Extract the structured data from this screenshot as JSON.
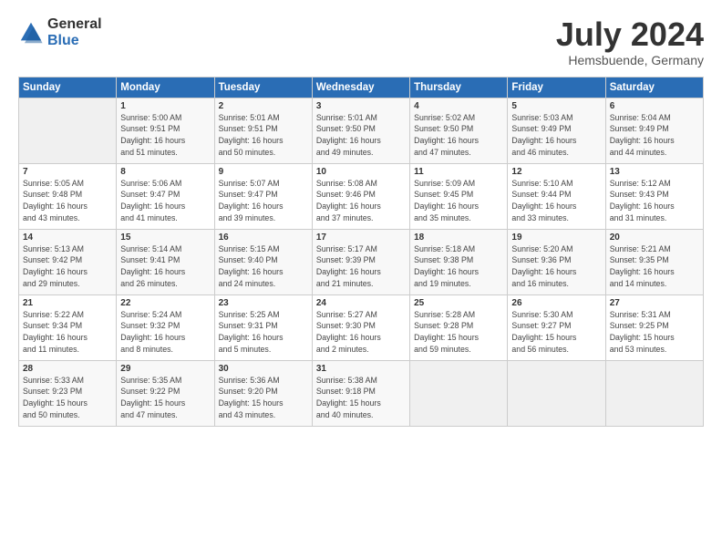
{
  "logo": {
    "general": "General",
    "blue": "Blue"
  },
  "header": {
    "month": "July 2024",
    "location": "Hemsbuende, Germany"
  },
  "weekdays": [
    "Sunday",
    "Monday",
    "Tuesday",
    "Wednesday",
    "Thursday",
    "Friday",
    "Saturday"
  ],
  "weeks": [
    [
      {
        "day": "",
        "info": ""
      },
      {
        "day": "1",
        "info": "Sunrise: 5:00 AM\nSunset: 9:51 PM\nDaylight: 16 hours\nand 51 minutes."
      },
      {
        "day": "2",
        "info": "Sunrise: 5:01 AM\nSunset: 9:51 PM\nDaylight: 16 hours\nand 50 minutes."
      },
      {
        "day": "3",
        "info": "Sunrise: 5:01 AM\nSunset: 9:50 PM\nDaylight: 16 hours\nand 49 minutes."
      },
      {
        "day": "4",
        "info": "Sunrise: 5:02 AM\nSunset: 9:50 PM\nDaylight: 16 hours\nand 47 minutes."
      },
      {
        "day": "5",
        "info": "Sunrise: 5:03 AM\nSunset: 9:49 PM\nDaylight: 16 hours\nand 46 minutes."
      },
      {
        "day": "6",
        "info": "Sunrise: 5:04 AM\nSunset: 9:49 PM\nDaylight: 16 hours\nand 44 minutes."
      }
    ],
    [
      {
        "day": "7",
        "info": "Sunrise: 5:05 AM\nSunset: 9:48 PM\nDaylight: 16 hours\nand 43 minutes."
      },
      {
        "day": "8",
        "info": "Sunrise: 5:06 AM\nSunset: 9:47 PM\nDaylight: 16 hours\nand 41 minutes."
      },
      {
        "day": "9",
        "info": "Sunrise: 5:07 AM\nSunset: 9:47 PM\nDaylight: 16 hours\nand 39 minutes."
      },
      {
        "day": "10",
        "info": "Sunrise: 5:08 AM\nSunset: 9:46 PM\nDaylight: 16 hours\nand 37 minutes."
      },
      {
        "day": "11",
        "info": "Sunrise: 5:09 AM\nSunset: 9:45 PM\nDaylight: 16 hours\nand 35 minutes."
      },
      {
        "day": "12",
        "info": "Sunrise: 5:10 AM\nSunset: 9:44 PM\nDaylight: 16 hours\nand 33 minutes."
      },
      {
        "day": "13",
        "info": "Sunrise: 5:12 AM\nSunset: 9:43 PM\nDaylight: 16 hours\nand 31 minutes."
      }
    ],
    [
      {
        "day": "14",
        "info": "Sunrise: 5:13 AM\nSunset: 9:42 PM\nDaylight: 16 hours\nand 29 minutes."
      },
      {
        "day": "15",
        "info": "Sunrise: 5:14 AM\nSunset: 9:41 PM\nDaylight: 16 hours\nand 26 minutes."
      },
      {
        "day": "16",
        "info": "Sunrise: 5:15 AM\nSunset: 9:40 PM\nDaylight: 16 hours\nand 24 minutes."
      },
      {
        "day": "17",
        "info": "Sunrise: 5:17 AM\nSunset: 9:39 PM\nDaylight: 16 hours\nand 21 minutes."
      },
      {
        "day": "18",
        "info": "Sunrise: 5:18 AM\nSunset: 9:38 PM\nDaylight: 16 hours\nand 19 minutes."
      },
      {
        "day": "19",
        "info": "Sunrise: 5:20 AM\nSunset: 9:36 PM\nDaylight: 16 hours\nand 16 minutes."
      },
      {
        "day": "20",
        "info": "Sunrise: 5:21 AM\nSunset: 9:35 PM\nDaylight: 16 hours\nand 14 minutes."
      }
    ],
    [
      {
        "day": "21",
        "info": "Sunrise: 5:22 AM\nSunset: 9:34 PM\nDaylight: 16 hours\nand 11 minutes."
      },
      {
        "day": "22",
        "info": "Sunrise: 5:24 AM\nSunset: 9:32 PM\nDaylight: 16 hours\nand 8 minutes."
      },
      {
        "day": "23",
        "info": "Sunrise: 5:25 AM\nSunset: 9:31 PM\nDaylight: 16 hours\nand 5 minutes."
      },
      {
        "day": "24",
        "info": "Sunrise: 5:27 AM\nSunset: 9:30 PM\nDaylight: 16 hours\nand 2 minutes."
      },
      {
        "day": "25",
        "info": "Sunrise: 5:28 AM\nSunset: 9:28 PM\nDaylight: 15 hours\nand 59 minutes."
      },
      {
        "day": "26",
        "info": "Sunrise: 5:30 AM\nSunset: 9:27 PM\nDaylight: 15 hours\nand 56 minutes."
      },
      {
        "day": "27",
        "info": "Sunrise: 5:31 AM\nSunset: 9:25 PM\nDaylight: 15 hours\nand 53 minutes."
      }
    ],
    [
      {
        "day": "28",
        "info": "Sunrise: 5:33 AM\nSunset: 9:23 PM\nDaylight: 15 hours\nand 50 minutes."
      },
      {
        "day": "29",
        "info": "Sunrise: 5:35 AM\nSunset: 9:22 PM\nDaylight: 15 hours\nand 47 minutes."
      },
      {
        "day": "30",
        "info": "Sunrise: 5:36 AM\nSunset: 9:20 PM\nDaylight: 15 hours\nand 43 minutes."
      },
      {
        "day": "31",
        "info": "Sunrise: 5:38 AM\nSunset: 9:18 PM\nDaylight: 15 hours\nand 40 minutes."
      },
      {
        "day": "",
        "info": ""
      },
      {
        "day": "",
        "info": ""
      },
      {
        "day": "",
        "info": ""
      }
    ]
  ]
}
